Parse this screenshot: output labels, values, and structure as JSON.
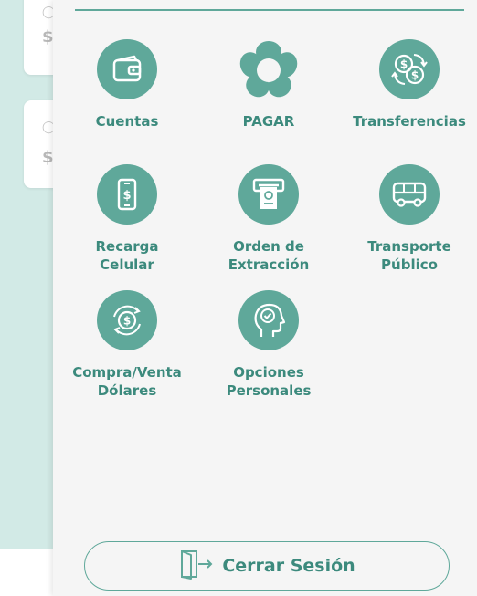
{
  "colors": {
    "accent": "#5fa89a",
    "label": "#3c8a7d",
    "drawer_bg": "#f5f5f5",
    "app_bg": "#d2eae6"
  },
  "background": {
    "cards": [
      {
        "symbol": "$"
      },
      {
        "symbol": "$"
      }
    ]
  },
  "menu": {
    "items": [
      {
        "label": "Cuentas",
        "icon": "wallet-icon"
      },
      {
        "label": "PAGAR",
        "icon": "flower-icon"
      },
      {
        "label": "Transferencias",
        "icon": "currency-exchange-icon"
      },
      {
        "label": "Recarga\nCelular",
        "icon": "phone-dollar-icon"
      },
      {
        "label": "Orden de\nExtracción",
        "icon": "atm-icon"
      },
      {
        "label": "Transporte\nPúblico",
        "icon": "bus-icon"
      },
      {
        "label": "Compra/Venta\nDólares",
        "icon": "dollar-cycle-icon"
      },
      {
        "label": "Opciones\nPersonales",
        "icon": "head-check-icon"
      }
    ]
  },
  "logout": {
    "label": "Cerrar Sesión",
    "icon": "exit-door-icon"
  }
}
